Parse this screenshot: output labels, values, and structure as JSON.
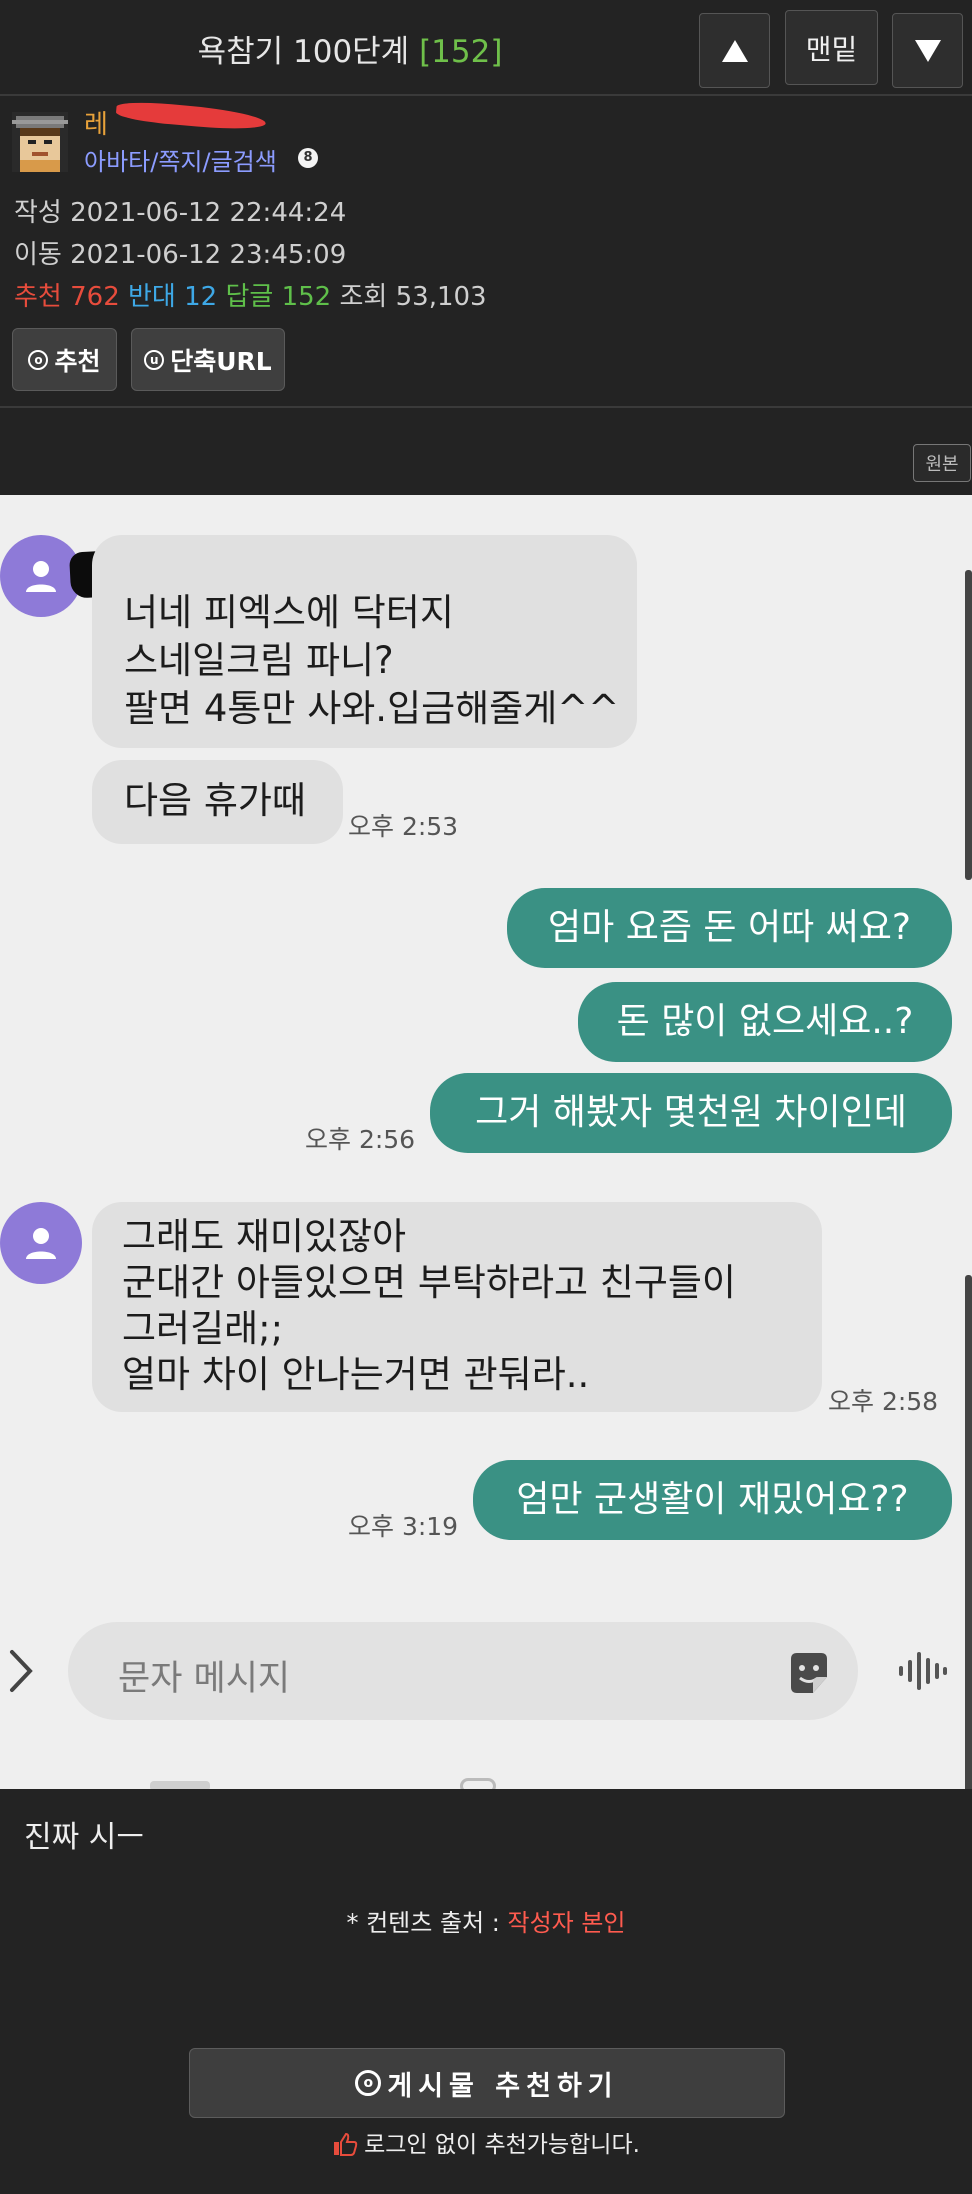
{
  "header": {
    "title": "욕참기 100단계",
    "reply_count": "[152]",
    "bottom_label": "맨밑"
  },
  "author": {
    "name": "레 ",
    "links": "아바타/쪽지/글검색",
    "badge": "8"
  },
  "meta": {
    "written": "작성 2021-06-12 22:44:24",
    "moved": "이동 2021-06-12 23:45:09",
    "recommend_label": "추천",
    "recommend_value": "762",
    "oppose_label": "반대",
    "oppose_value": "12",
    "reply_label": "답글",
    "reply_value": "152",
    "views_label": "조회",
    "views_value": "53,103"
  },
  "actions": {
    "recommend": "추천",
    "short_url": "단축URL",
    "original": "원본"
  },
  "chat": {
    "messages": [
      {
        "side": "in",
        "lines": [
          "너네 피엑스에 닥터지",
          "스네일크림 파니?",
          "팔면 4통만 사와.입금해줄게^^"
        ]
      },
      {
        "side": "in",
        "lines": [
          "다음 휴가때"
        ],
        "time": "오후 2:53"
      },
      {
        "side": "out",
        "lines": [
          "엄마 요즘 돈 어따 써요?"
        ]
      },
      {
        "side": "out",
        "lines": [
          "돈 많이 없으세요..?"
        ]
      },
      {
        "side": "out",
        "lines": [
          "그거 해봤자 몇천원 차이인데"
        ],
        "time": "오후 2:56"
      },
      {
        "side": "in",
        "lines": [
          "그래도 재미있잖아",
          "군대간 아들있으면 부탁하라고 친구들이",
          "그러길래;;",
          "얼마 차이 안나는거면 관둬라.."
        ],
        "time": "오후 2:58"
      },
      {
        "side": "out",
        "lines": [
          "엄만 군생활이 재밌어요??"
        ],
        "time": "오후 3:19"
      }
    ],
    "compose_placeholder": "문자 메시지"
  },
  "post": {
    "caption": "진짜 시ㅡ",
    "source_prefix": "* 컨텐츠 출처 : ",
    "source_value": "작성자 본인",
    "recommend_button": "게시물 추천하기",
    "login_note": "로그인 없이 추천가능합니다."
  },
  "colors": {
    "accent_green": "#3a9184",
    "recommend_red": "#e74c3c",
    "oppose_blue": "#3ea8e6",
    "reply_green": "#5fbf4a",
    "author_orange": "#e8a23a",
    "link_purple": "#8c9cff",
    "avatar_purple": "#8e7ad8"
  },
  "icons": [
    "arrow-up-icon",
    "arrow-down-icon",
    "recommend-icon",
    "url-icon",
    "person-icon",
    "chevron-right-icon",
    "sticker-icon",
    "voice-icon",
    "thumbs-up-icon"
  ]
}
